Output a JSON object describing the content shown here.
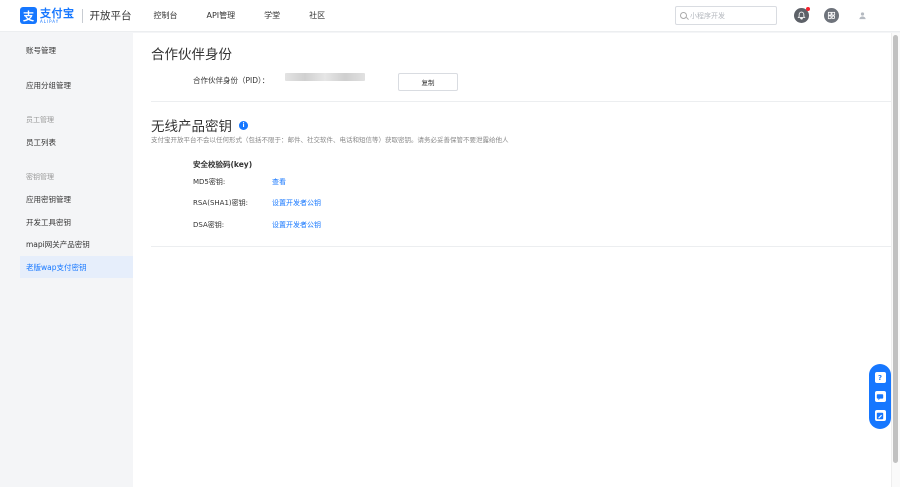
{
  "header": {
    "logo_cn": "支付宝",
    "logo_en": "ALIPAY",
    "title": "开放平台",
    "nav": [
      "控制台",
      "API管理",
      "学堂",
      "社区"
    ],
    "search_placeholder": "小程序开发"
  },
  "sidebar": {
    "items": [
      {
        "label": "账号管理"
      },
      {
        "label": "应用分组管理"
      }
    ],
    "group_staff": "员工管理",
    "staff_items": [
      {
        "label": "员工列表"
      }
    ],
    "group_keys": "密钥管理",
    "key_items": [
      {
        "label": "应用密钥管理"
      },
      {
        "label": "开发工具密钥"
      },
      {
        "label": "mapi网关产品密钥"
      },
      {
        "label": "老版wap支付密钥",
        "active": true
      }
    ]
  },
  "partner": {
    "title": "合作伙伴身份",
    "pid_label": "合作伙伴身份（PID）：",
    "copy_label": "复制"
  },
  "wireless": {
    "title": "无线产品密钥",
    "info_glyph": "i",
    "description": "支付宝开放平台不会以任何形式（包括不限于：邮件、社交软件、电话和短信等）获取密钥。请务必妥善保管不要泄露给他人",
    "key_header": "安全校验码(key)",
    "keys": [
      {
        "label": "MD5密钥:",
        "action": "查看"
      },
      {
        "label": "RSA(SHA1)密钥:",
        "action": "设置开发者公钥"
      },
      {
        "label": "DSA密钥:",
        "action": "设置开发者公钥"
      }
    ]
  },
  "colors": {
    "accent": "#1677ff",
    "sidebar_active_bg": "#e6eefb",
    "page_bg": "#f4f5f7"
  }
}
